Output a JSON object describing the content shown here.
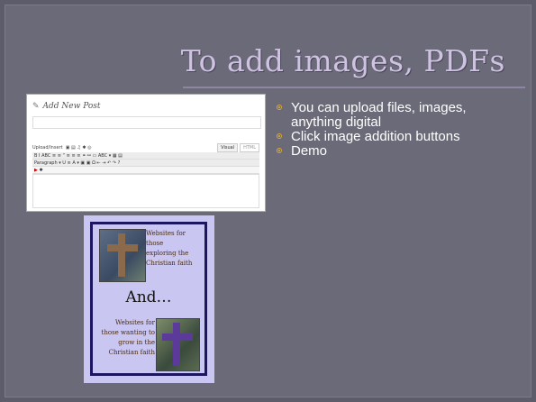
{
  "slide": {
    "title": "To add images, PDFs",
    "bullets": [
      "You can upload files, images, anything digital",
      "Click image addition buttons",
      "Demo"
    ]
  },
  "screenshot": {
    "heading": "Add New Post",
    "upload_insert_label": "Upload/Insert",
    "tabs": [
      "Visual",
      "HTML"
    ],
    "toolbar_row1": "B  I  ABC  ≡  ≡  “  ≡  ≡  ≡  ⚭  ⚯  ▭  ABC ▾  ▦  ▤",
    "toolbar_row2": "Paragraph ▾  U  ≡  A ▾  ▣  ▣  Ω  ⇤  ⇥  ↶  ↷  ?"
  },
  "poster": {
    "text_top": [
      "Websites for",
      "those",
      "exploring the",
      "Christian faith"
    ],
    "middle": "And…",
    "text_bottom": [
      "Websites for",
      "those wanting to",
      "grow in the",
      "Christian faith"
    ]
  },
  "colors": {
    "slide_bg": "#6a6a78",
    "title": "#cfc3e2",
    "bullet_marker": "#d8a838",
    "poster_bg": "#c9c7f1",
    "poster_frame": "#1c1660"
  }
}
